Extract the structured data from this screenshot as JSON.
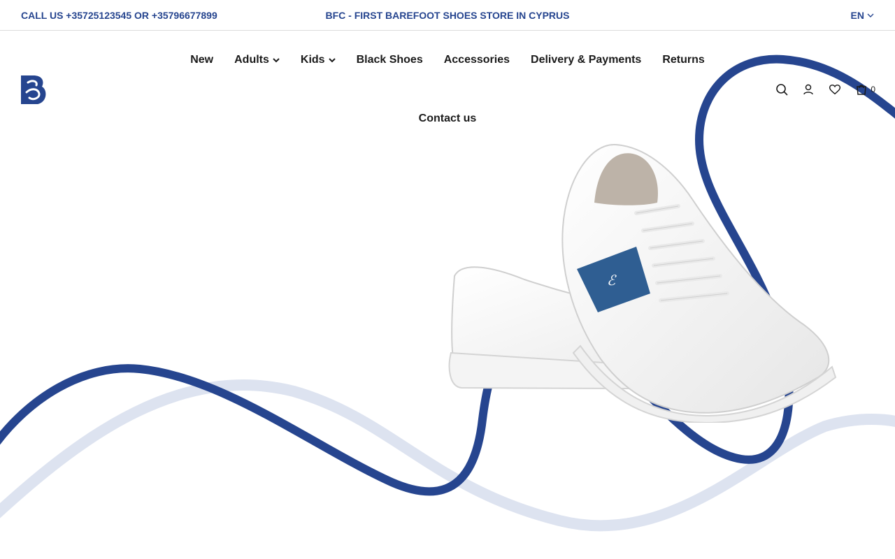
{
  "announcement": {
    "phone_text": "CALL US +35725123545 OR +35796677899",
    "tagline": "BFC - FIRST BAREFOOT SHOES STORE IN CYPRUS",
    "language": "EN"
  },
  "nav": {
    "items": [
      {
        "label": "New"
      },
      {
        "label": "Adults",
        "has_dropdown": true
      },
      {
        "label": "Kids",
        "has_dropdown": true
      },
      {
        "label": "Black Shoes"
      },
      {
        "label": "Accessories"
      },
      {
        "label": "Delivery & Payments"
      },
      {
        "label": "Returns"
      },
      {
        "label": "Contact us"
      }
    ]
  },
  "header": {
    "logo_icon": "bfc-b-logo",
    "icons": [
      "search-icon",
      "account-icon",
      "wishlist-heart-icon",
      "cart-bag-icon"
    ],
    "cart_count": "0"
  },
  "colors": {
    "brand_blue": "#26458f",
    "light_wave": "#dde3f0",
    "text": "#1a1a1a"
  }
}
